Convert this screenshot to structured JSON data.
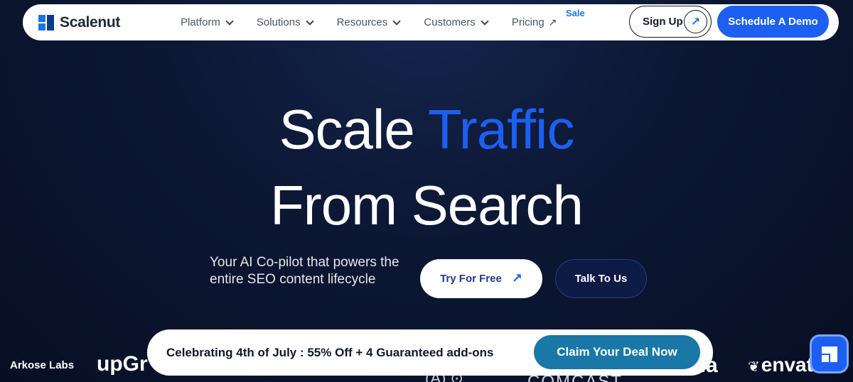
{
  "brand": {
    "name": "Scalenut",
    "primary_color": "#1d5ff0"
  },
  "nav": {
    "items": [
      {
        "label": "Platform",
        "icon": "chevron-down-icon"
      },
      {
        "label": "Solutions",
        "icon": "chevron-down-icon"
      },
      {
        "label": "Resources",
        "icon": "chevron-down-icon"
      },
      {
        "label": "Customers",
        "icon": "chevron-down-icon"
      },
      {
        "label": "Pricing",
        "icon": "external-arrow-icon"
      }
    ],
    "sale_badge": "Sale",
    "signup_label": "Sign Up",
    "demo_label": "Schedule A Demo"
  },
  "hero": {
    "line1_white": "Scale",
    "line1_accent": "Traffic",
    "line2": "From Search",
    "subtitle": "Your AI Co-pilot that powers the entire SEO content lifecycle",
    "try_label": "Try For Free",
    "talk_label": "Talk To Us"
  },
  "clients": {
    "arkose": "Arkose Labs",
    "upgrad": "upGr",
    "partial1": "(A)  ⊙",
    "comcast": "COMCAST",
    "ala": "ala",
    "envato": "envat"
  },
  "promo": {
    "text": "Celebrating 4th of July : 55% Off + 4 Guaranteed add-ons",
    "cta_label": "Claim Your Deal Now"
  }
}
